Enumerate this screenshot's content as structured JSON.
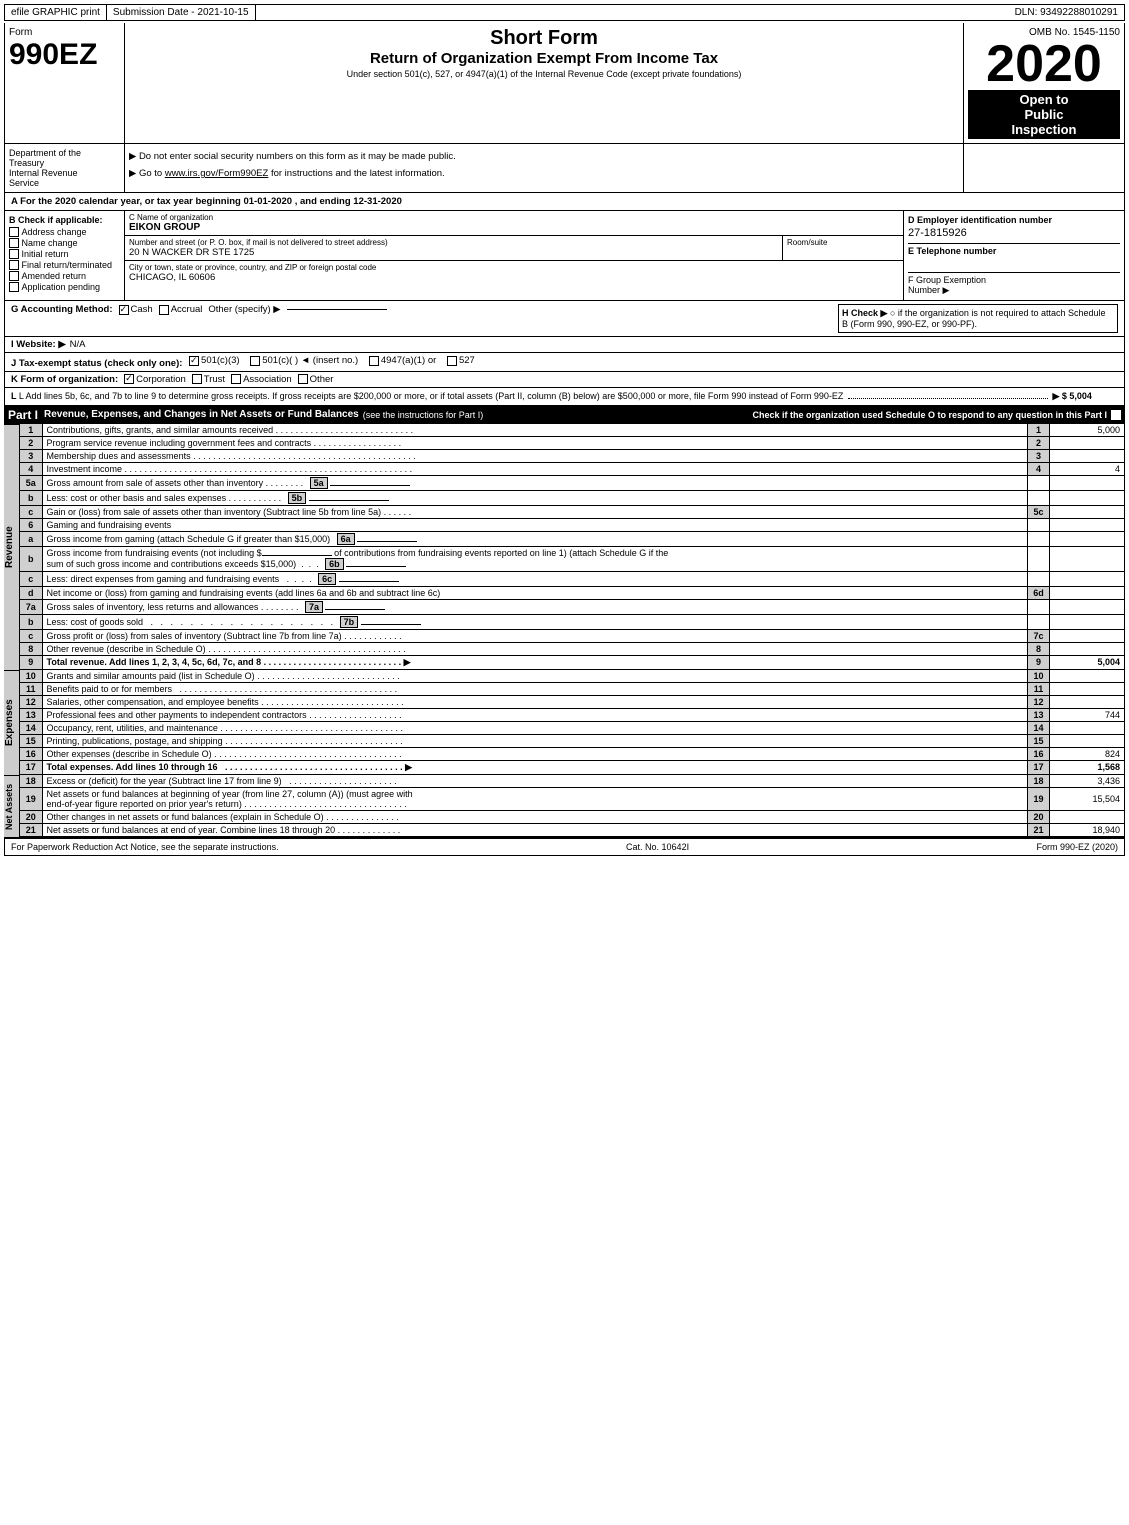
{
  "topBar": {
    "efile": "efile GRAPHIC print",
    "submissionLabel": "Submission Date - 2021-10-15",
    "dln": "DLN: 93492288010291"
  },
  "header": {
    "formLabel": "Form",
    "formNumber": "990EZ",
    "shortFormTitle": "Short Form",
    "returnTitle": "Return of Organization Exempt From Income Tax",
    "subtitle": "Under section 501(c), 527, or 4947(a)(1) of the Internal Revenue Code (except private foundations)",
    "ombLabel": "OMB No. 1545-1150",
    "year": "2020",
    "openToPublic": "Open to",
    "publicLabel": "Public",
    "inspectionLabel": "Inspection"
  },
  "instructions": {
    "line1": "▶ Do not enter social security numbers on this form as it may be made public.",
    "line2": "▶ Go to www.irs.gov/Form990EZ for instructions and the latest information.",
    "link": "www.irs.gov/Form990EZ"
  },
  "dept": {
    "line1": "Department of the",
    "line2": "Treasury",
    "line3": "Internal Revenue",
    "line4": "Service"
  },
  "taxYear": {
    "text": "A For the 2020 calendar year, or tax year beginning 01-01-2020 , and ending 12-31-2020"
  },
  "checkIfApplicable": {
    "label": "B Check if applicable:",
    "items": [
      {
        "label": "Address change",
        "checked": false
      },
      {
        "label": "Name change",
        "checked": false
      },
      {
        "label": "Initial return",
        "checked": false
      },
      {
        "label": "Final return/terminated",
        "checked": false
      },
      {
        "label": "Amended return",
        "checked": false
      },
      {
        "label": "Application pending",
        "checked": false
      }
    ]
  },
  "orgInfo": {
    "nameLabelC": "C Name of organization",
    "orgName": "EIKON GROUP",
    "addressLabel": "Number and street (or P. O. box, if mail is not delivered to street address)",
    "address": "20 N WACKER DR STE 1725",
    "roomLabel": "Room/suite",
    "cityLabel": "City or town, state or province, country, and ZIP or foreign postal code",
    "city": "CHICAGO, IL  60606",
    "einLabelD": "D Employer identification number",
    "ein": "27-1815926",
    "phoneLabelE": "E Telephone number",
    "groupExemptionF": "F Group Exemption",
    "numberLabel": "Number",
    "numberArrow": "▶"
  },
  "accounting": {
    "gLabel": "G Accounting Method:",
    "cashLabel": "Cash",
    "cashChecked": true,
    "accrualLabel": "Accrual",
    "accrualChecked": false,
    "otherLabel": "Other (specify) ▶",
    "hLabel": "H Check ▶",
    "hText": "○ if the organization is not required to attach Schedule B (Form 990, 990-EZ, or 990-PF)."
  },
  "website": {
    "label": "I Website: ▶",
    "value": "N/A"
  },
  "taxStatus": {
    "jLabel": "J Tax-exempt status (check only one):",
    "options": [
      {
        "label": "501(c)(3)",
        "checked": true
      },
      {
        "label": "501(c)(  )",
        "checked": false,
        "insertNo": "(insert no.)"
      },
      {
        "label": "4947(a)(1) or",
        "checked": false
      },
      {
        "label": "527",
        "checked": false
      }
    ]
  },
  "formOrg": {
    "kLabel": "K Form of organization:",
    "options": [
      {
        "label": "Corporation",
        "checked": true
      },
      {
        "label": "Trust",
        "checked": false
      },
      {
        "label": "Association",
        "checked": false
      },
      {
        "label": "Other",
        "checked": false
      }
    ]
  },
  "addLines": {
    "lText": "L Add lines 5b, 6c, and 7b to line 9 to determine gross receipts. If gross receipts are $200,000 or more, or if total assets (Part II, column (B) below) are $500,000 or more, file Form 990 instead of Form 990-EZ",
    "amount": "▶ $ 5,004"
  },
  "partI": {
    "label": "Part I",
    "title": "Revenue, Expenses, and Changes in Net Assets or Fund Balances",
    "seeInstructions": "(see the instructions for Part I)",
    "checkNote": "Check if the organization used Schedule O to respond to any question in this Part I",
    "rows": [
      {
        "num": "1",
        "desc": "Contributions, gifts, grants, and similar amounts received",
        "col": "1",
        "val": "5,000"
      },
      {
        "num": "2",
        "desc": "Program service revenue including government fees and contracts",
        "col": "2",
        "val": ""
      },
      {
        "num": "3",
        "desc": "Membership dues and assessments",
        "col": "3",
        "val": ""
      },
      {
        "num": "4",
        "desc": "Investment income",
        "col": "4",
        "val": "4"
      },
      {
        "num": "5a",
        "desc": "Gross amount from sale of assets other than inventory",
        "col": "5a",
        "val": "",
        "inline": true
      },
      {
        "num": "b",
        "desc": "Less: cost or other basis and sales expenses",
        "col": "5b",
        "val": "",
        "inline": true
      },
      {
        "num": "c",
        "desc": "Gain or (loss) from sale of assets other than inventory (Subtract line 5b from line 5a)",
        "col": "5c",
        "val": ""
      },
      {
        "num": "6",
        "desc": "Gaming and fundraising events",
        "col": "",
        "val": "",
        "header": true
      },
      {
        "num": "a",
        "desc": "Gross income from gaming (attach Schedule G if greater than $15,000)",
        "col": "6a",
        "val": "",
        "inline": true
      },
      {
        "num": "b",
        "desc": "Gross income from fundraising events (not including $_____ of contributions from fundraising events reported on line 1) (attach Schedule G if the sum of such gross income and contributions exceeds $15,000)",
        "col": "6b",
        "val": "",
        "inline": true
      },
      {
        "num": "c",
        "desc": "Less: direct expenses from gaming and fundraising events",
        "col": "6c",
        "val": "",
        "inline": true
      },
      {
        "num": "d",
        "desc": "Net income or (loss) from gaming and fundraising events (add lines 6a and 6b and subtract line 6c)",
        "col": "6d",
        "val": ""
      },
      {
        "num": "7a",
        "desc": "Gross sales of inventory, less returns and allowances",
        "col": "7a",
        "val": "",
        "inline": true
      },
      {
        "num": "b",
        "desc": "Less: cost of goods sold",
        "col": "7b",
        "val": "",
        "inline": true
      },
      {
        "num": "c",
        "desc": "Gross profit or (loss) from sales of inventory (Subtract line 7b from line 7a)",
        "col": "7c",
        "val": ""
      },
      {
        "num": "8",
        "desc": "Other revenue (describe in Schedule O)",
        "col": "8",
        "val": ""
      },
      {
        "num": "9",
        "desc": "Total revenue. Add lines 1, 2, 3, 4, 5c, 6d, 7c, and 8",
        "col": "9",
        "val": "5,004",
        "bold": true,
        "arrow": true
      }
    ]
  },
  "partIExpenses": {
    "rows": [
      {
        "num": "10",
        "desc": "Grants and similar amounts paid (list in Schedule O)",
        "col": "10",
        "val": ""
      },
      {
        "num": "11",
        "desc": "Benefits paid to or for members",
        "col": "11",
        "val": ""
      },
      {
        "num": "12",
        "desc": "Salaries, other compensation, and employee benefits",
        "col": "12",
        "val": ""
      },
      {
        "num": "13",
        "desc": "Professional fees and other payments to independent contractors",
        "col": "13",
        "val": "744"
      },
      {
        "num": "14",
        "desc": "Occupancy, rent, utilities, and maintenance",
        "col": "14",
        "val": ""
      },
      {
        "num": "15",
        "desc": "Printing, publications, postage, and shipping",
        "col": "15",
        "val": ""
      },
      {
        "num": "16",
        "desc": "Other expenses (describe in Schedule O)",
        "col": "16",
        "val": "824"
      },
      {
        "num": "17",
        "desc": "Total expenses. Add lines 10 through 16",
        "col": "17",
        "val": "1,568",
        "bold": true,
        "arrow": true
      }
    ]
  },
  "partINetAssets": {
    "rows": [
      {
        "num": "18",
        "desc": "Excess or (deficit) for the year (Subtract line 17 from line 9)",
        "col": "18",
        "val": "3,436"
      },
      {
        "num": "19",
        "desc": "Net assets or fund balances at beginning of year (from line 27, column (A)) (must agree with end-of-year figure reported on prior year's return)",
        "col": "19",
        "val": "15,504"
      },
      {
        "num": "20",
        "desc": "Other changes in net assets or fund balances (explain in Schedule O)",
        "col": "20",
        "val": ""
      },
      {
        "num": "21",
        "desc": "Net assets or fund balances at end of year. Combine lines 18 through 20",
        "col": "21",
        "val": "18,940"
      }
    ]
  },
  "footer": {
    "paperworkText": "For Paperwork Reduction Act Notice, see the separate instructions.",
    "catNo": "Cat. No. 10642I",
    "formRef": "Form 990-EZ (2020)"
  }
}
